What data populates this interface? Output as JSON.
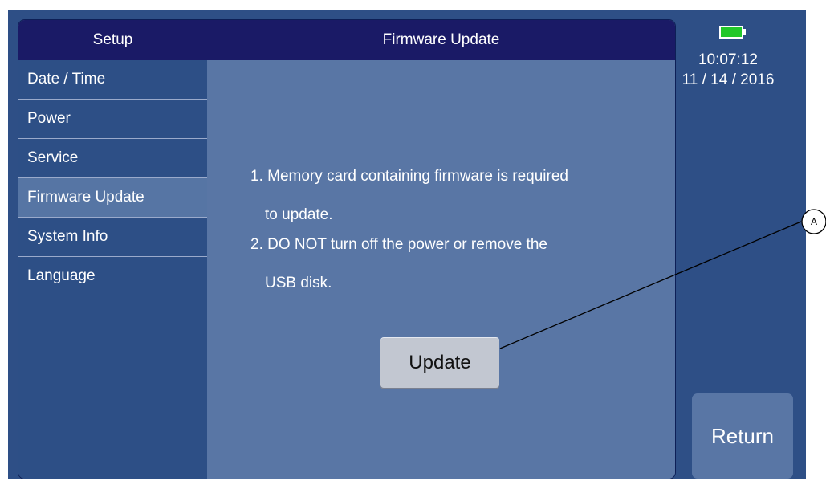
{
  "header": {
    "left_title": "Setup",
    "title": "Firmware Update"
  },
  "sidebar": {
    "items": [
      {
        "label": "Date / Time",
        "active": false
      },
      {
        "label": "Power",
        "active": false
      },
      {
        "label": "Service",
        "active": false
      },
      {
        "label": "Firmware Update",
        "active": true
      },
      {
        "label": "System Info",
        "active": false
      },
      {
        "label": "Language",
        "active": false
      }
    ]
  },
  "content": {
    "instructions": [
      "1. Memory card containing firmware is required",
      "to update.",
      "2. DO NOT turn off the power or remove the",
      "USB disk."
    ],
    "update_button": "Update"
  },
  "status": {
    "battery_icon": "battery-full-icon",
    "battery_color": "#22c82a",
    "time": "10:07:12",
    "date": "11 / 14 / 2016"
  },
  "return_button": "Return",
  "callout": {
    "label": "A"
  },
  "colors": {
    "header_bg": "#1a1a66",
    "sidebar_bg": "#2d4f86",
    "content_bg": "#5976a5",
    "active_item_bg": "#5675a4",
    "button_bg": "#c2c7d1"
  }
}
